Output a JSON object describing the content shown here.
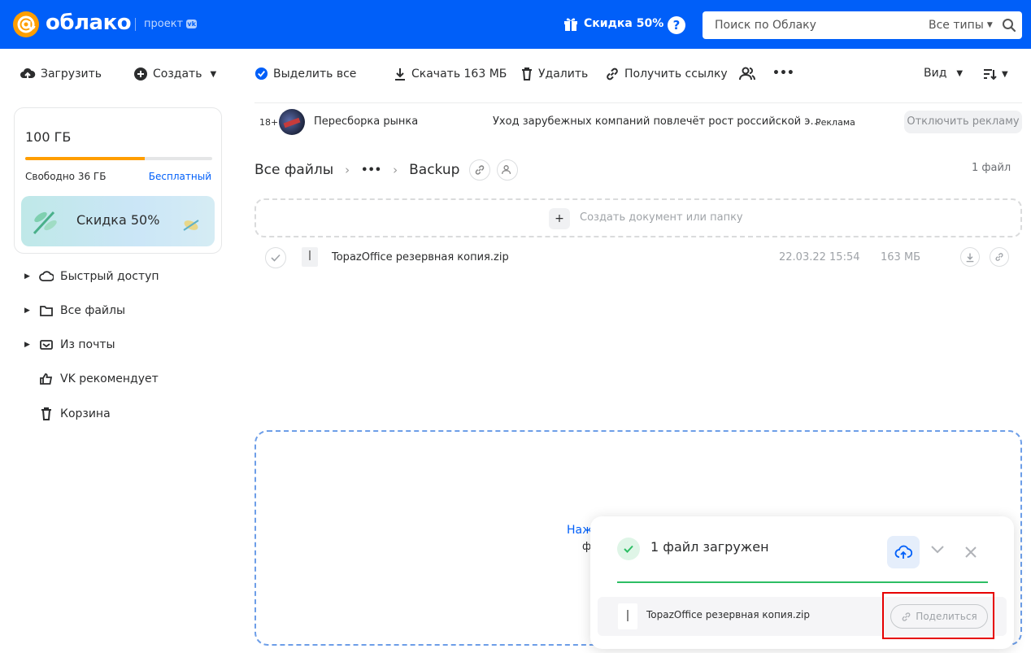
{
  "header": {
    "logo_text": "облако",
    "project_label": "проект",
    "vk_badge": "vk",
    "promo_label": "Скидка 50%",
    "help_label": "?",
    "search": {
      "placeholder": "Поиск по Облаку",
      "types_label": "Все типы"
    }
  },
  "toolbar": {
    "upload_label": "Загрузить",
    "create_label": "Создать",
    "select_all_label": "Выделить все",
    "download_label": "Скачать 163 МБ",
    "delete_label": "Удалить",
    "get_link_label": "Получить ссылку",
    "more_label": "•••",
    "view_label": "Вид"
  },
  "sidebar": {
    "storage_total": "100 ГБ",
    "storage_used_fraction": 0.64,
    "free_label": "Свободно 36 ГБ",
    "plan_label": "Бесплатный",
    "banner_label": "Скидка 50%",
    "items": [
      {
        "label": "Быстрый доступ",
        "icon": "cloud-icon",
        "expandable": true
      },
      {
        "label": "Все файлы",
        "icon": "folder-icon",
        "expandable": true
      },
      {
        "label": "Из почты",
        "icon": "mail-icon",
        "expandable": true
      },
      {
        "label": "VK рекомендует",
        "icon": "thumbs-up-icon",
        "expandable": false
      },
      {
        "label": "Корзина",
        "icon": "trash-icon",
        "expandable": false
      }
    ]
  },
  "ad": {
    "age_label": "18+",
    "source": "Пересборка рынка",
    "headline": "Уход зарубежных компаний повлечёт рост российской э…",
    "tag": "Реклама",
    "disable_label": "Отключить рекламу"
  },
  "breadcrumbs": {
    "root": "Все файлы",
    "ellipsis": "•••",
    "current": "Backup",
    "count_label": "1 файл"
  },
  "create_bar": {
    "plus": "+",
    "label": "Создать документ или папку"
  },
  "files": [
    {
      "name": "TopazOffice резервная копия.zip",
      "date": "22.03.22 15:54",
      "size": "163 МБ"
    }
  ],
  "dropzone": {
    "text_line1": "Наж",
    "text_line2": "ф"
  },
  "upload_panel": {
    "status": "1 файл загружен",
    "progress": 1.0,
    "file_name": "TopazOffice резервная копия.zip",
    "share_label": "Поделиться"
  },
  "colors": {
    "brand_blue": "#005ff9",
    "accent_orange": "#ff9e00",
    "success_green": "#2dbe64",
    "highlight_red": "#e60000"
  }
}
